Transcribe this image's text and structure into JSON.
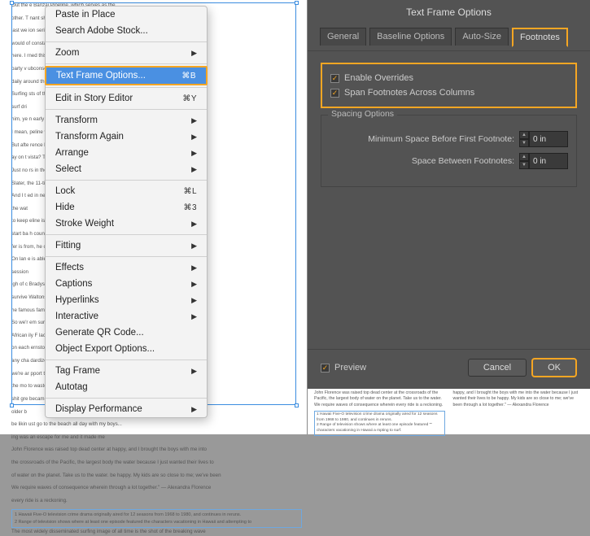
{
  "contextMenu": {
    "items": [
      {
        "label": "Paste in Place",
        "shortcut": "",
        "arrow": false
      },
      {
        "label": "Search Adobe Stock...",
        "shortcut": "",
        "arrow": false
      },
      {
        "sep": true
      },
      {
        "label": "Zoom",
        "shortcut": "",
        "arrow": true
      },
      {
        "sep": true
      },
      {
        "label": "Text Frame Options...",
        "shortcut": "⌘B",
        "arrow": false,
        "highlighted": true
      },
      {
        "sep": true
      },
      {
        "label": "Edit in Story Editor",
        "shortcut": "⌘Y",
        "arrow": false
      },
      {
        "sep": true
      },
      {
        "label": "Transform",
        "shortcut": "",
        "arrow": true
      },
      {
        "label": "Transform Again",
        "shortcut": "",
        "arrow": true
      },
      {
        "label": "Arrange",
        "shortcut": "",
        "arrow": true
      },
      {
        "label": "Select",
        "shortcut": "",
        "arrow": true
      },
      {
        "sep": true
      },
      {
        "label": "Lock",
        "shortcut": "⌘L",
        "arrow": false
      },
      {
        "label": "Hide",
        "shortcut": "⌘3",
        "arrow": false
      },
      {
        "label": "Stroke Weight",
        "shortcut": "",
        "arrow": true
      },
      {
        "sep": true
      },
      {
        "label": "Fitting",
        "shortcut": "",
        "arrow": true
      },
      {
        "sep": true
      },
      {
        "label": "Effects",
        "shortcut": "",
        "arrow": true
      },
      {
        "label": "Captions",
        "shortcut": "",
        "arrow": true
      },
      {
        "label": "Hyperlinks",
        "shortcut": "",
        "arrow": true
      },
      {
        "label": "Interactive",
        "shortcut": "",
        "arrow": true
      },
      {
        "label": "Generate QR Code...",
        "shortcut": "",
        "arrow": false
      },
      {
        "label": "Object Export Options...",
        "shortcut": "",
        "arrow": false
      },
      {
        "sep": true
      },
      {
        "label": "Tag Frame",
        "shortcut": "",
        "arrow": true
      },
      {
        "label": "Autotag",
        "shortcut": "",
        "arrow": false
      },
      {
        "sep": true
      },
      {
        "label": "Display Performance",
        "shortcut": "",
        "arrow": true
      }
    ]
  },
  "dialog": {
    "title": "Text Frame Options",
    "tabs": [
      "General",
      "Baseline Options",
      "Auto-Size",
      "Footnotes"
    ],
    "activeTab": 3,
    "enableOverrides": {
      "label": "Enable Overrides",
      "checked": true
    },
    "spanFootnotes": {
      "label": "Span Footnotes Across Columns",
      "checked": true
    },
    "spacingLabel": "Spacing Options",
    "minSpaceLabel": "Minimum Space Before First Footnote:",
    "minSpaceValue": "0 in",
    "betweenLabel": "Space Between Footnotes:",
    "betweenValue": "0 in",
    "preview": {
      "label": "Preview",
      "checked": true
    },
    "cancel": "Cancel",
    "ok": "OK"
  },
  "doc": {
    "col1": {
      "p1": "Out the                                                                 e Banzai Pipeline, which serves as the",
      "p2": "other. T                                                                 nant shot in the opening of the 1960s",
      "p3": "last we                                                                  ion series Hawaii Five-O\". Forty-seven",
      "p4": "would                                                                    of constant repetition of the pipescape",
      "p5": "here. I                                                                  rned this iconic image into our collec-",
      "p6": "party v                                                                  ubconscious. The wave continues to be",
      "p7": "                                                                         daily around the world on syndicated",
      "p8": "Surfing                                                                  sts of the crime drama series.",
      "p9": "surf dri",
      "p10": "him, ye                                                                 n early age the hollow, spiraling waves",
      "p11": "I mean,                                                                 peline were the principal view from the",
      "p12": "But afte                                                                rence brothers' tree house. How great is",
      "p13": "ay on t                                                                 vista? They have witnessed the greatest",
      "p14": "Just no                                                                 rs in the world daily from center stage.",
      "p15": "                                                                         Slater, the 11-time world champion, even",
      "p16": "And I t                                                                 ed in next door.",
      "p17": "the wat",
      "p18": "to keep                                                                 eline is the only thing and it matters not",
      "p19": "start ba                                                                h country, which state, or which island",
      "p20": "                                                                         fer is from, he comes to Pipeline as",
      "p21": "On lan                                                                  e is able.\" — Chas Smith",
      "p22": "session",
      "p23": "igh of c                                                                Bradys. The Huxtables. The Sopranos.",
      "p24": "survive                                                                 Waltons. The Bundys. The Jeffersons\".",
      "p25": "                                                                         he famous families on television, none",
      "p26": "So we'r                                                                 em surf as well as the Florences. And",
      "p27": "African                                                                 ily F lacks a warm, fuzzy paterfamilias,",
      "p28": "on each                                                                 ernstone oracle of broadcast network-",
      "p29": "any cha                                                                 dardized family values. A woman working",
      "p30": "we're ar                                                                pport three children in her own is too",
      "p31": "the mo                                                                  to waste time wondering why some papa",
      "p32": "shit gre                                                                became lost in the woods.",
      "p33": "older b",
      "p34": "be likin                                                                ust go to the beach all day with my boys...",
      "p35": "                                                                         ing was an escape for me and it made me",
      "p36": "John Florence was raised top dead center at     happy, and I brought the boys with me into",
      "p37": "the crossroads of the Pacific, the largest body     the water because I just wanted their lives to",
      "p38": "of water on the planet. Take us to the water.     be happy. My kids are so close to me; we've been",
      "p39": "We require waves of consequence wherein     through a lot together.\" — Alexandra Florence",
      "p40": "every ride is a reckoning.",
      "fn1": "1   Hawaii Five-O television crime drama originally aired for 12 seasons from 1968 to 1980, and continues in reruns.",
      "fn2": "2   Range of television shows where at least one episode featured the characters vacationing in Hawaii and attempting to",
      "p41": "The most widely disseminated surfing image of all time is the shot of the breaking wave"
    },
    "bottom": {
      "c1p1": "John Florence was raised top dead center at the crossroads of the Pacific, the largest body of water on the planet. Take us to the water. We require waves of consequence wherein every ride is a reckoning.",
      "c2p1": "happy, and I brought the boys with me into the water because I just wanted their lives to be happy. My kids are so close to me; we've been through a lot together.\" — Alexandra Florence",
      "fn1": "1   Hawaii Five-O television crime drama originally aired for 12 seasons from 1968 to 1980, and continues in reruns.",
      "fn2": "2   Range of television shows where at least one episode featured \"\" characters vacationing in Hawaii a       mpting to surf."
    }
  }
}
